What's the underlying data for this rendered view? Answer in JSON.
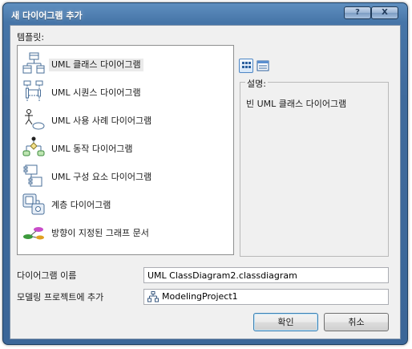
{
  "window": {
    "title": "새 다이어그램 추가",
    "help_button": "?",
    "close_button": "X"
  },
  "templates": {
    "label": "템플릿:",
    "items": [
      {
        "label": "UML 클래스 다이어그램",
        "icon": "class-diagram-icon",
        "selected": true
      },
      {
        "label": "UML 시퀀스 다이어그램",
        "icon": "sequence-diagram-icon",
        "selected": false
      },
      {
        "label": "UML 사용 사례 다이어그램",
        "icon": "use-case-diagram-icon",
        "selected": false
      },
      {
        "label": "UML 동작 다이어그램",
        "icon": "activity-diagram-icon",
        "selected": false
      },
      {
        "label": "UML 구성 요소 다이어그램",
        "icon": "component-diagram-icon",
        "selected": false
      },
      {
        "label": "계층 다이어그램",
        "icon": "layer-diagram-icon",
        "selected": false
      },
      {
        "label": "방향이 지정된 그래프 문서",
        "icon": "directed-graph-icon",
        "selected": false
      }
    ]
  },
  "view_buttons": {
    "grid": "large-icons-view-icon",
    "list": "list-view-icon"
  },
  "description": {
    "legend": "설명:",
    "text": "빈 UML 클래스 다이어그램"
  },
  "form": {
    "name_label": "다이어그램 이름",
    "name_value": "UML ClassDiagram2.classdiagram",
    "project_label": "모델링 프로젝트에 추가",
    "project_value": "ModelingProject1"
  },
  "buttons": {
    "ok": "확인",
    "cancel": "취소"
  },
  "colors": {
    "title_bar": "#4675a8",
    "client_bg": "#f0f0f0",
    "selection_bg": "#eaeaea"
  }
}
